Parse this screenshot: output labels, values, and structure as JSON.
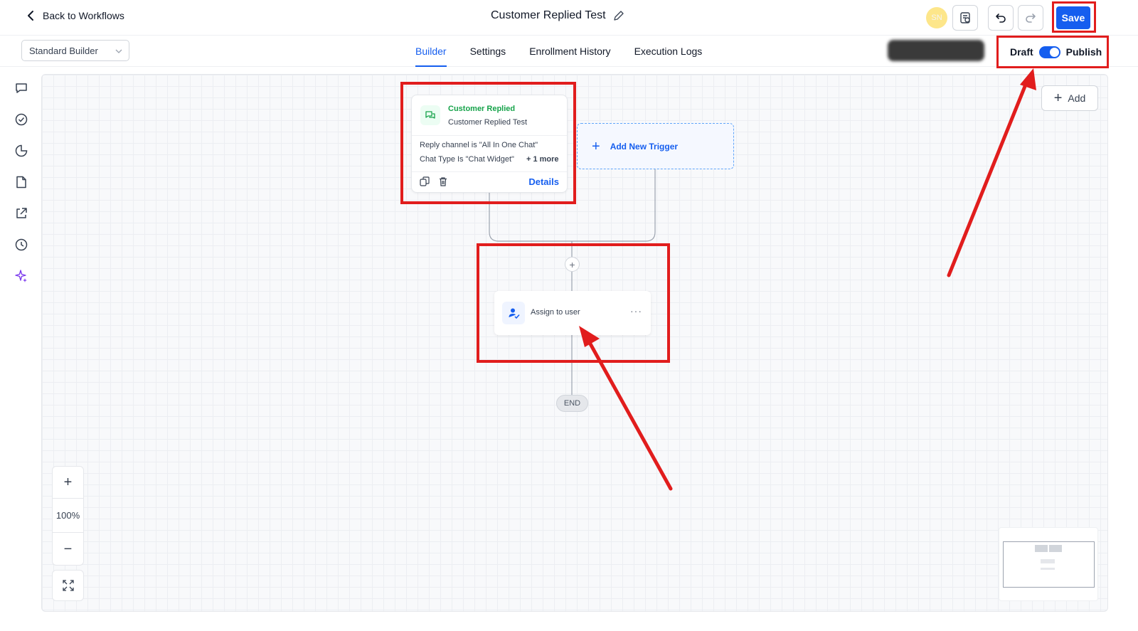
{
  "header": {
    "back_label": "Back to Workflows",
    "workflow_title": "Customer Replied Test",
    "avatar_initials": "SN",
    "save_label": "Save"
  },
  "subbar": {
    "builder_select_value": "Standard Builder",
    "tabs": [
      {
        "label": "Builder",
        "active": true
      },
      {
        "label": "Settings",
        "active": false
      },
      {
        "label": "Enrollment History",
        "active": false
      },
      {
        "label": "Execution Logs",
        "active": false
      }
    ],
    "toggle": {
      "left_label": "Draft",
      "right_label": "Publish",
      "on": true
    }
  },
  "sidebar": {
    "icons": [
      "chat-icon",
      "check-circle-icon",
      "pie-chart-icon",
      "document-icon",
      "external-link-icon",
      "history-icon",
      "sparkle-icon"
    ]
  },
  "canvas": {
    "add_label": "Add",
    "trigger": {
      "title": "Customer Replied",
      "subtitle": "Customer Replied Test",
      "condition_1": "Reply channel is \"All In One Chat\"",
      "condition_2": "Chat Type Is \"Chat Widget\"",
      "more": "+ 1 more",
      "details": "Details"
    },
    "new_trigger_label": "Add New Trigger",
    "action": {
      "label": "Assign to user",
      "more": "···"
    },
    "end_label": "END",
    "zoom": {
      "level": "100%",
      "plus": "+",
      "minus": "−"
    }
  },
  "colors": {
    "accent": "#155eef",
    "trigger_green": "#16a34a",
    "annotation_red": "#e11d1d"
  }
}
